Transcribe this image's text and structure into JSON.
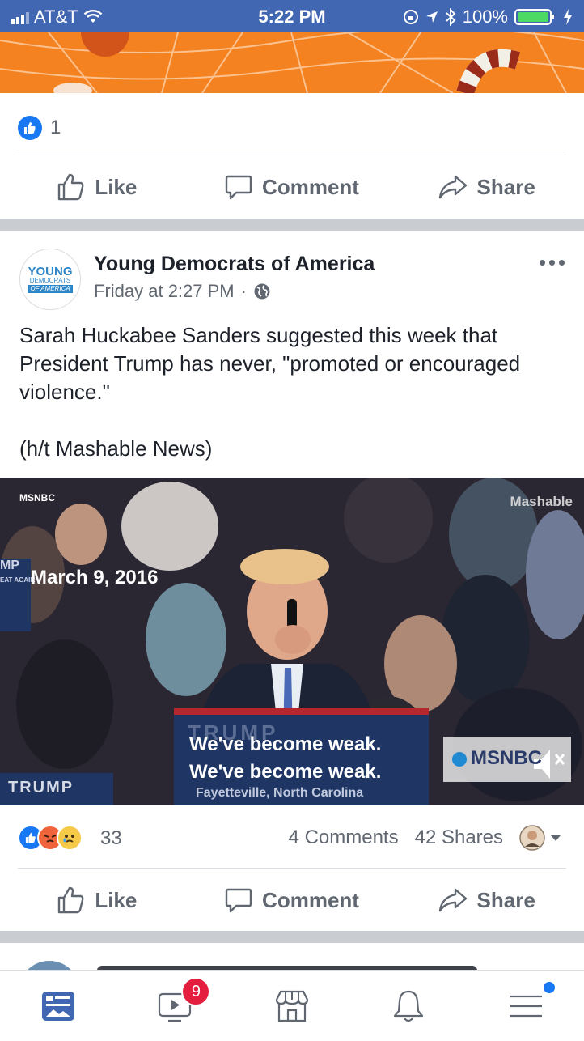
{
  "status_bar": {
    "carrier": "AT&T",
    "time": "5:22 PM",
    "battery": "100%"
  },
  "prev_post": {
    "like_count": "1",
    "actions": {
      "like": "Like",
      "comment": "Comment",
      "share": "Share"
    }
  },
  "post": {
    "page_name": "Young Democrats of America",
    "timestamp": "Friday at 2:27 PM",
    "audience_separator": "·",
    "avatar": {
      "line1": "YOUNG",
      "line2": "DEMOCRATS",
      "line3": "OF AMERICA"
    },
    "text_p1": "Sarah Huckabee Sanders suggested this week that President Trump has never, \"promoted or encouraged violence.\"",
    "text_p2": "(h/t Mashable News)",
    "video": {
      "source_label": "MSNBC",
      "watermark": "Mashable",
      "date_caption": "March 9, 2016",
      "caption_line1": "We've become weak.",
      "caption_line2": "We've become weak.",
      "location": "Fayetteville, North Carolina",
      "sign_text": "TRUMP",
      "network_logo": "MSNBC",
      "podium_text": "TRUMP",
      "side_text": "MP",
      "side_subtext": "EAT AGAIN!"
    },
    "reactions_count": "33",
    "comments_count": "4 Comments",
    "shares_count": "42 Shares",
    "actions": {
      "like": "Like",
      "comment": "Comment",
      "share": "Share"
    }
  },
  "tab_bar": {
    "video_badge": "9"
  },
  "colors": {
    "fb_blue": "#4267b2",
    "like_blue": "#1877f2",
    "banner_orange": "#f58220",
    "text_grey": "#606770"
  }
}
